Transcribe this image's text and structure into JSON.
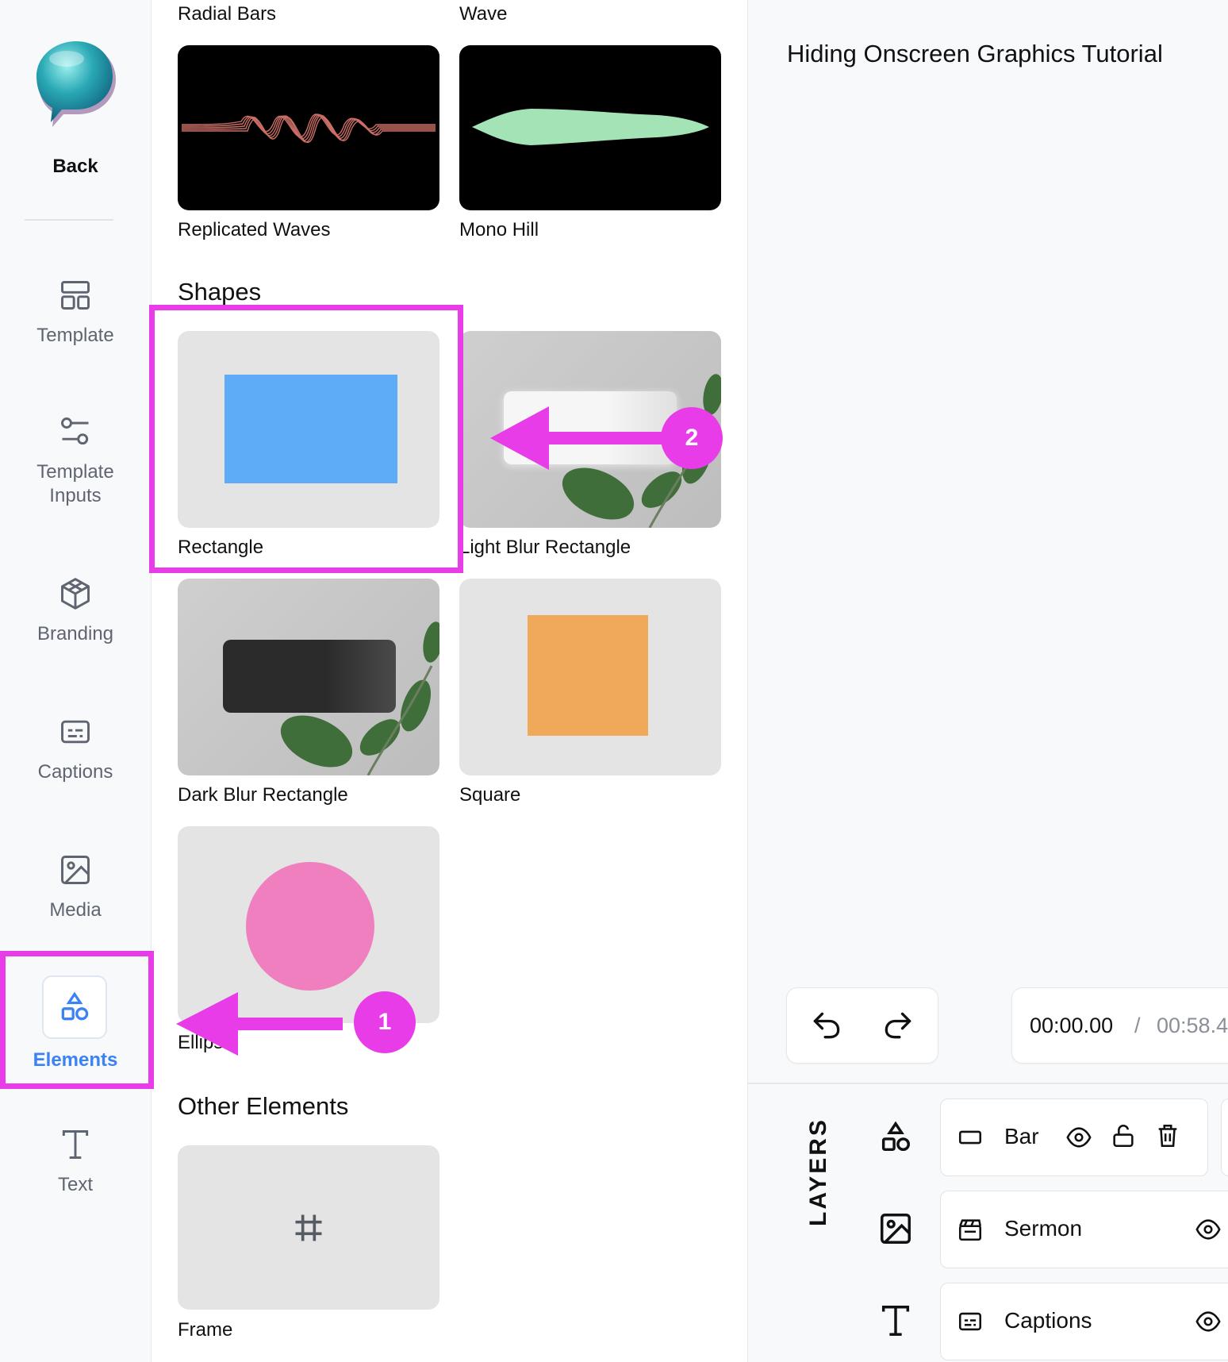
{
  "nav": {
    "back_label": "Back",
    "items": [
      {
        "label": "Template",
        "icon": "layout-icon"
      },
      {
        "label": "Template\nInputs",
        "icon": "sliders-icon"
      },
      {
        "label": "Branding",
        "icon": "cube-icon"
      },
      {
        "label": "Captions",
        "icon": "captions-icon"
      },
      {
        "label": "Media",
        "icon": "image-icon"
      },
      {
        "label": "Elements",
        "icon": "shapes-icon",
        "active": true
      },
      {
        "label": "Text",
        "icon": "text-icon"
      }
    ],
    "accent_color": "#3b82f6"
  },
  "panel": {
    "top_captions": [
      "Radial Bars",
      "Wave"
    ],
    "waves": [
      {
        "label": "Replicated Waves"
      },
      {
        "label": "Mono Hill"
      }
    ],
    "shapes_title": "Shapes",
    "shapes": [
      {
        "label": "Rectangle"
      },
      {
        "label": "Light Blur Rectangle"
      },
      {
        "label": "Dark Blur Rectangle"
      },
      {
        "label": "Square"
      },
      {
        "label": "Ellipse"
      }
    ],
    "other_title": "Other Elements",
    "other": [
      {
        "label": "Frame"
      }
    ]
  },
  "right": {
    "project_title": "Hiding Onscreen Graphics Tutorial",
    "time_current": "00:00.00",
    "time_separator": "/",
    "time_total": "00:58.4",
    "layers_label": "LAYERS",
    "layers": [
      {
        "name": "Bar",
        "icon": "rectangle-icon"
      },
      {
        "name": "Sermon",
        "icon": "clapper-icon"
      },
      {
        "name": "Captions",
        "icon": "captions-icon"
      }
    ]
  },
  "annotations": {
    "badge_1": "1",
    "badge_2": "2",
    "color": "#e93ce9"
  }
}
